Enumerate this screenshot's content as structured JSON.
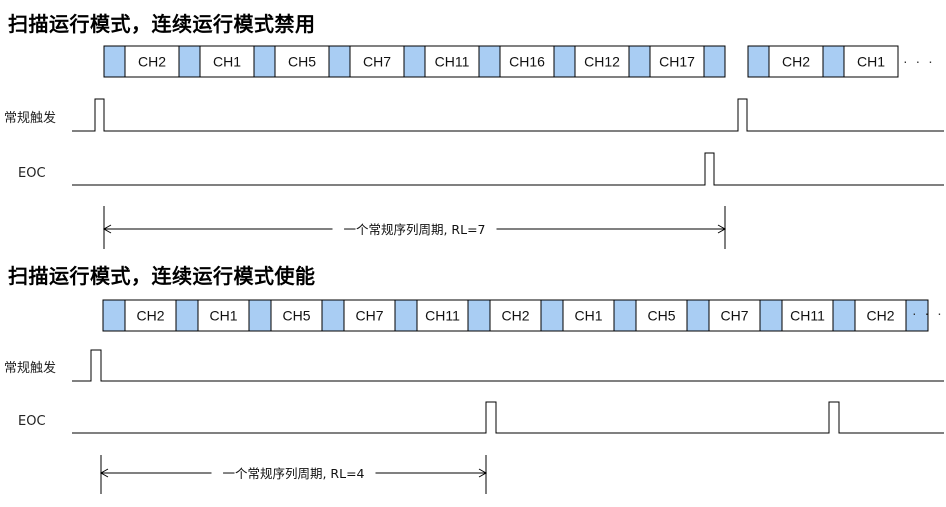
{
  "diagram_1": {
    "title": "扫描运行模式，连续运行模式禁用",
    "sequence_channels": [
      "CH2",
      "CH1",
      "CH5",
      "CH7",
      "CH11",
      "CH16",
      "CH12",
      "CH17"
    ],
    "next_channels": [
      "CH2",
      "CH1"
    ],
    "ellipsis": "· · ·",
    "trigger_label": "常规触发",
    "eoc_label": "EOC",
    "period_label": "一个常规序列周期, RL=7"
  },
  "diagram_2": {
    "title": "扫描运行模式，连续运行模式使能",
    "sequence_channels": [
      "CH2",
      "CH1",
      "CH5",
      "CH7",
      "CH11",
      "CH2",
      "CH1",
      "CH5",
      "CH7",
      "CH11",
      "CH2"
    ],
    "ellipsis": "· · ·",
    "trigger_label": "常规触发",
    "eoc_label": "EOC",
    "period_label": "一个常规序列周期, RL=4"
  },
  "colors": {
    "sample_block": "#a9cdf3",
    "line": "#000000"
  }
}
